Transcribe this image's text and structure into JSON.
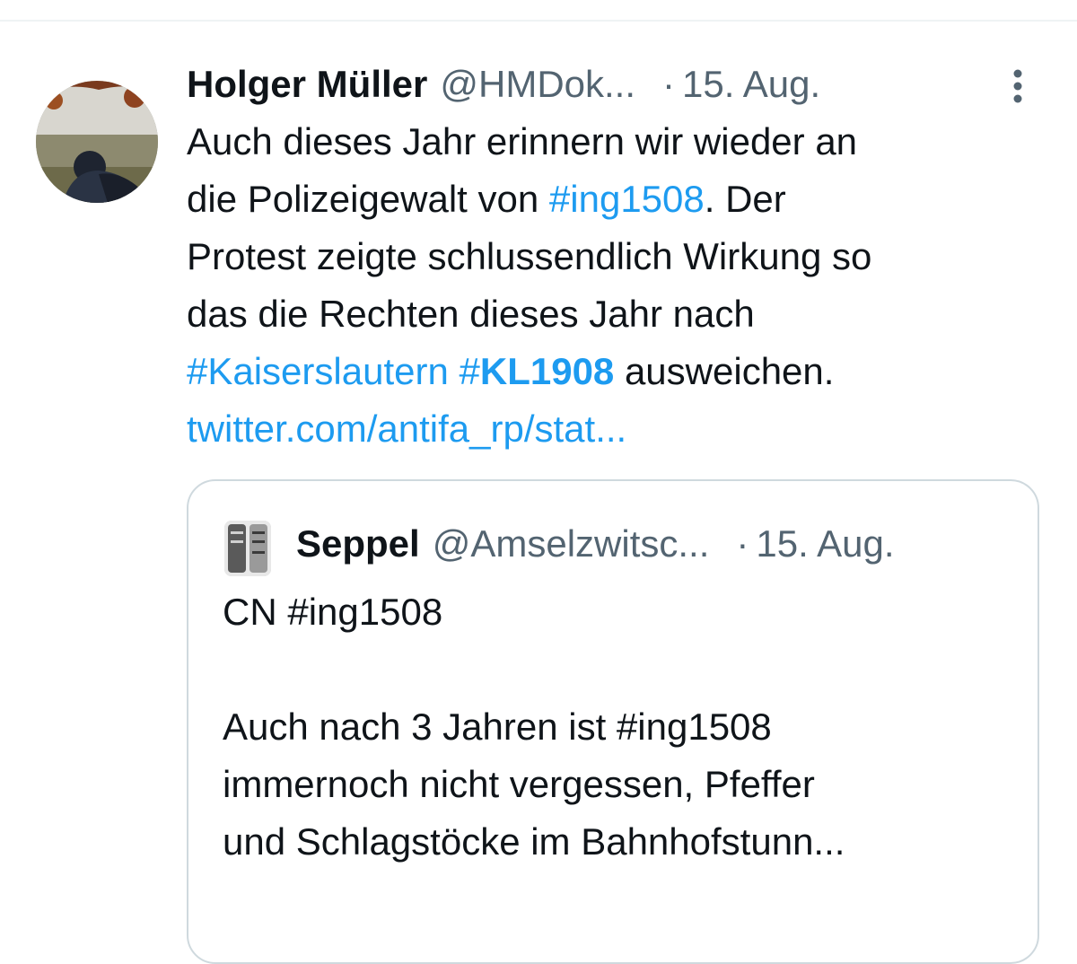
{
  "tweet": {
    "author_name": "Holger Müller",
    "author_handle": "@HMDok...",
    "separator": "·",
    "date": "15. Aug.",
    "more_icon": "more-vertical-icon",
    "text": {
      "line1": "Auch dieses Jahr erinnern wir wieder an",
      "line2_pre": "die Polizeigewalt von ",
      "line2_tag": "#ing1508",
      "line2_post": ". Der",
      "line3": "Protest zeigte schlussendlich Wirkung so",
      "line4": "das die Rechten dieses Jahr nach",
      "line5_tag1": "#Kaiserslautern",
      "line5_space": " ",
      "line5_tag2_hash": "#",
      "line5_tag2_word": "KL1908",
      "line5_post": " ausweichen.",
      "link": "twitter.com/antifa_rp/stat..."
    }
  },
  "quote": {
    "author_name": "Seppel",
    "author_handle": "@Amselzwitsc...",
    "separator": "·",
    "date": "15. Aug.",
    "text": {
      "line1": "CN #ing1508",
      "line2": "",
      "line3": "Auch nach 3 Jahren ist #ing1508",
      "line4": "immernoch nicht vergessen, Pfeffer",
      "line5": "und Schlagstöcke im Bahnhofstunn..."
    }
  },
  "colors": {
    "link": "#1d9bf0",
    "secondary_text": "#536471",
    "primary_text": "#0f1419",
    "border": "#cfd9de"
  }
}
